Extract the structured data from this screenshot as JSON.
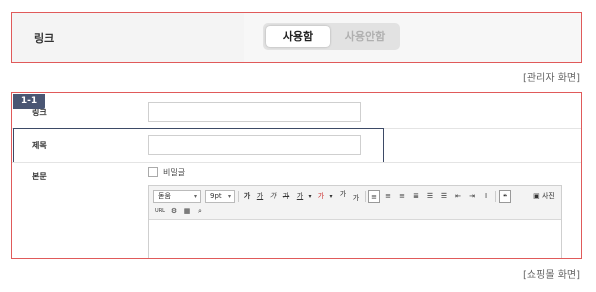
{
  "admin": {
    "label": "링크",
    "toggle_on": "사용함",
    "toggle_off": "사용안함",
    "caption": "[관리자 화면]"
  },
  "shop": {
    "badge": "1-1",
    "fields": {
      "link_label": "링크",
      "title_label": "제목",
      "body_label": "본문"
    },
    "secret_label": "비밀글",
    "caption": "[쇼핑몰 화면]"
  },
  "editor": {
    "font_family": "돋움",
    "font_size": "9pt",
    "bold": "가",
    "underline": "가",
    "italic": "가",
    "strike": "가",
    "font_color": "가",
    "highlight": "가",
    "superscript": "가",
    "subscript": "가",
    "quote": "❝",
    "photo": "사진",
    "url": "URL"
  }
}
